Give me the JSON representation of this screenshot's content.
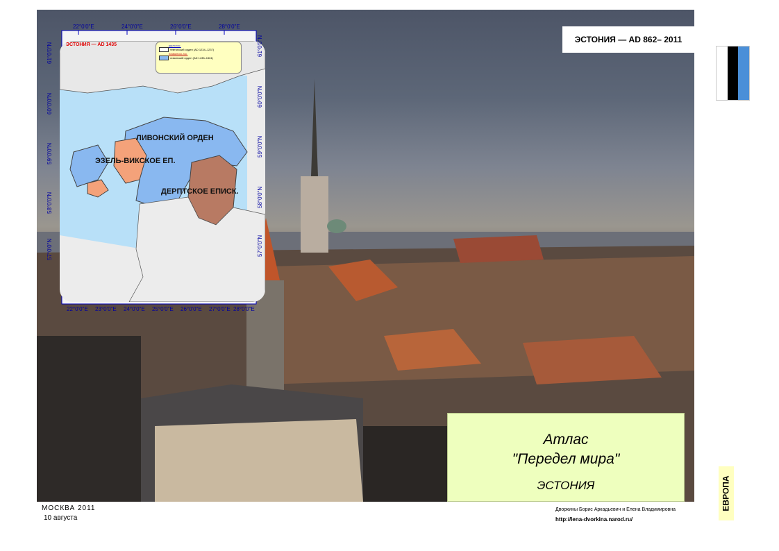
{
  "header": {
    "title": "ЭСТОНИЯ — AD 862– 2011"
  },
  "flag": {
    "colors": [
      "#ffffff",
      "#000000",
      "#4a8fd8"
    ]
  },
  "map": {
    "title": "ЭСТОНИЯ — AD 1435",
    "legend": {
      "gone_heading": "ушло гос.",
      "gone_item": "тевтонский орден (AD 1234–1237)",
      "appeared_heading": "появилось гос.",
      "appeared_item": "ливонский орден (AD 1435–1561)"
    },
    "labels": {
      "livonian": "ЛИВОНСКИЙ ОРДЕН",
      "osel": "ЭЗЕЛЬ-ВИКСКОЕ ЕП.",
      "dorpat": "ДЕРПТСКОЕ ЕПИСК."
    },
    "top_ticks": [
      "22°0'0\"E",
      "24°0'0\"E",
      "26°0'0\"E",
      "28°0'0\"E"
    ],
    "bottom_ticks": [
      "22°0'0\"E",
      "23°0'0\"E",
      "24°0'0\"E",
      "25°0'0\"E",
      "26°0'0\"E",
      "27°0'0\"E",
      "28°0'0\"E"
    ],
    "left_ticks": [
      "61°0'0\"N",
      "60°0'0\"N",
      "59°0'0\"N",
      "58°0'0\"N",
      "57°0'0\"N"
    ],
    "right_ticks": [
      "61°0'0\"N",
      "60°0'0\"N",
      "59°0'0\"N",
      "58°0'0\"N",
      "57°0'0\"N"
    ]
  },
  "atlas": {
    "title": "Атлас",
    "subtitle": "\"Передел мира\"",
    "country": "ЭСТОНИЯ"
  },
  "region_tag": "ЕВРОПА",
  "footer": {
    "city": "МОСКВА   2011",
    "date": "10 августа",
    "authors": "Дворкины Борис Аркадьевич и Елена Владимировна",
    "website": "http://lena-dvorkina.narod.ru/"
  }
}
